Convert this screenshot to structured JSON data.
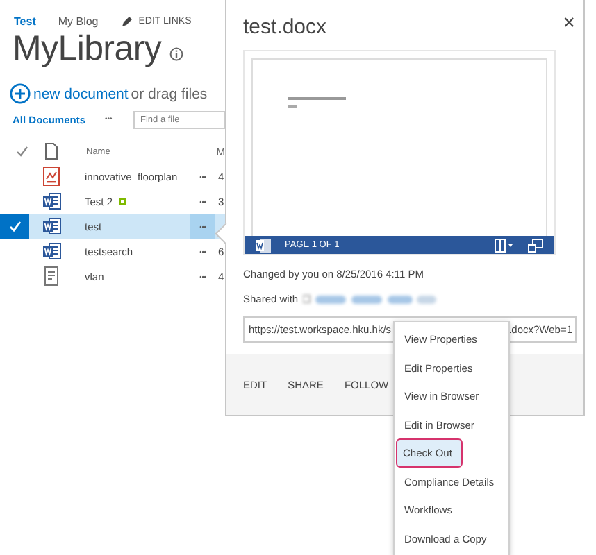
{
  "top_nav": [
    {
      "label": "Test",
      "selected": true
    },
    {
      "label": "My Blog",
      "selected": false
    }
  ],
  "edit_links": "EDIT LINKS",
  "title": "MyLibrary",
  "new_document": {
    "link": "new document",
    "text": "or drag files"
  },
  "view": {
    "label": "All Documents",
    "more": "•••",
    "search_placeholder": "Find a file"
  },
  "table": {
    "columns": [
      "Name",
      "M"
    ],
    "rows": [
      {
        "kind": "pdf",
        "name": "innovative_floorplan",
        "new": false,
        "selected": false,
        "more": "•••",
        "column_2": "4"
      },
      {
        "kind": "word",
        "name": "Test 2",
        "new": true,
        "selected": false,
        "more": "•••",
        "column_2": "3"
      },
      {
        "kind": "word",
        "name": "test",
        "new": false,
        "selected": true,
        "more": "•••"
      },
      {
        "kind": "word",
        "name": "testsearch",
        "new": false,
        "selected": false,
        "more": "•••",
        "column_2": "6"
      },
      {
        "kind": "text",
        "name": "vlan",
        "new": false,
        "selected": false,
        "more": "•••",
        "column_2": "4"
      }
    ]
  },
  "callout": {
    "title": "test.docx",
    "close": "×",
    "preview": {
      "page_label": "PAGE 1 OF 1"
    },
    "changed": "Changed by you on 8/25/2016 4:11 PM",
    "shared_with": "Shared with",
    "url": {
      "start": "https://test.workspace.hku.hk/s",
      "end": ".docx?Web=1"
    },
    "actions": [
      "EDIT",
      "SHARE",
      "FOLLOW"
    ]
  },
  "menu": [
    {
      "label": "View Properties",
      "selected": false
    },
    {
      "label": "Edit Properties",
      "selected": false
    },
    {
      "label": "View in Browser",
      "selected": false
    },
    {
      "label": "Edit in Browser",
      "selected": false
    },
    {
      "label": "Check Out",
      "selected": true
    },
    {
      "label": "Compliance Details",
      "selected": false
    },
    {
      "label": "Workflows",
      "selected": false
    },
    {
      "label": "Download a Copy",
      "selected": false
    }
  ]
}
